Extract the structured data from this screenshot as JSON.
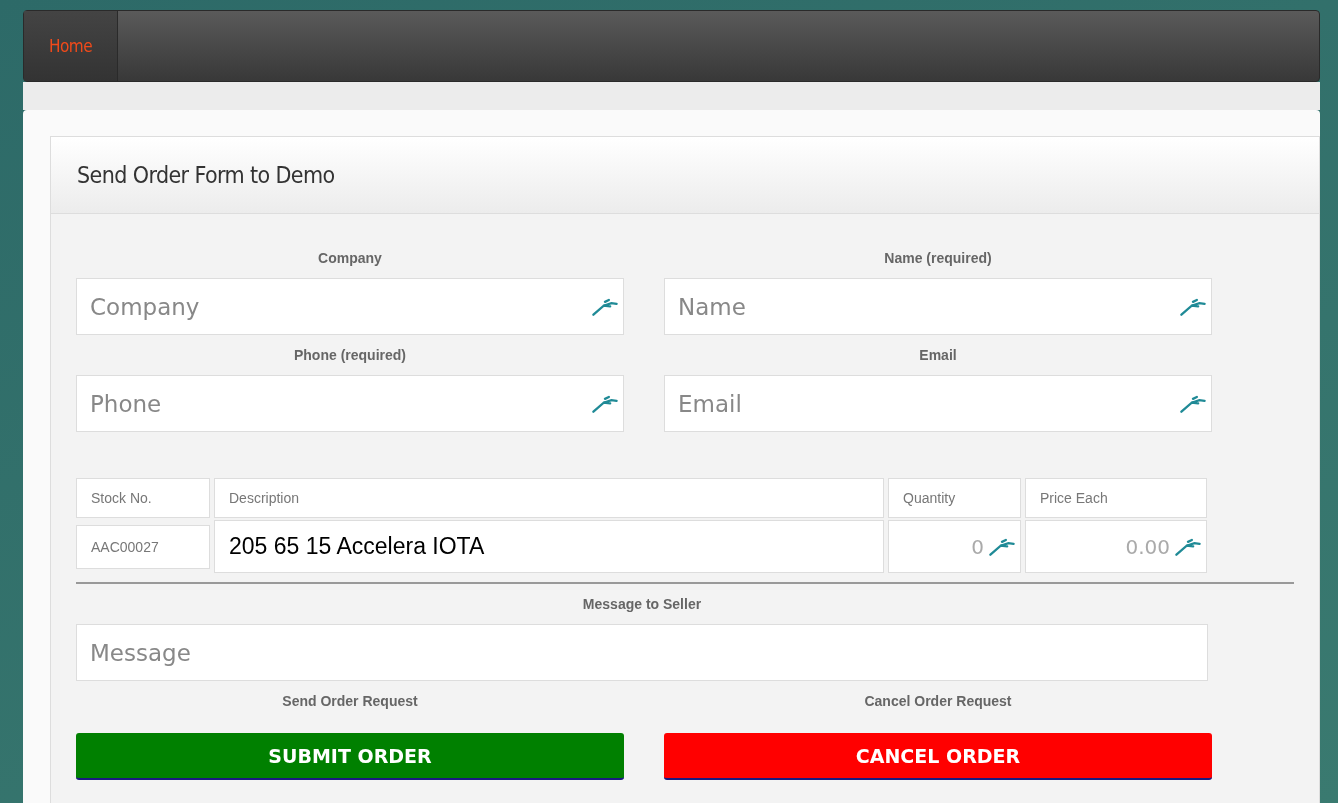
{
  "nav": [
    {
      "label": "Home",
      "selected": true
    }
  ],
  "panel": {
    "title": "Send Order Form to Demo"
  },
  "fields": [
    {
      "label": "Company",
      "placeholder": "Company"
    },
    {
      "label": "Name (required)",
      "placeholder": "Name"
    },
    {
      "label": "Phone (required)",
      "placeholder": "Phone"
    },
    {
      "label": "Email",
      "placeholder": "Email"
    }
  ],
  "order_table": {
    "columns": [
      "Stock No.",
      "Description",
      "Quantity",
      "Price Each"
    ],
    "rows": [
      [
        {
          "kind": "readonly",
          "value": "AAC00027"
        },
        {
          "kind": "text",
          "value": "205 65 15 Accelera IOTA"
        },
        {
          "kind": "number",
          "placeholder": "0"
        },
        {
          "kind": "number",
          "placeholder": "0.00"
        }
      ]
    ]
  },
  "message": {
    "label": "Message to Seller",
    "placeholder": "Message"
  },
  "actions": [
    {
      "kind": "submit",
      "label": "Send Order Request",
      "button": "SUBMIT ORDER"
    },
    {
      "kind": "cancel",
      "label": "Cancel Order Request",
      "button": "CANCEL ORDER"
    }
  ]
}
